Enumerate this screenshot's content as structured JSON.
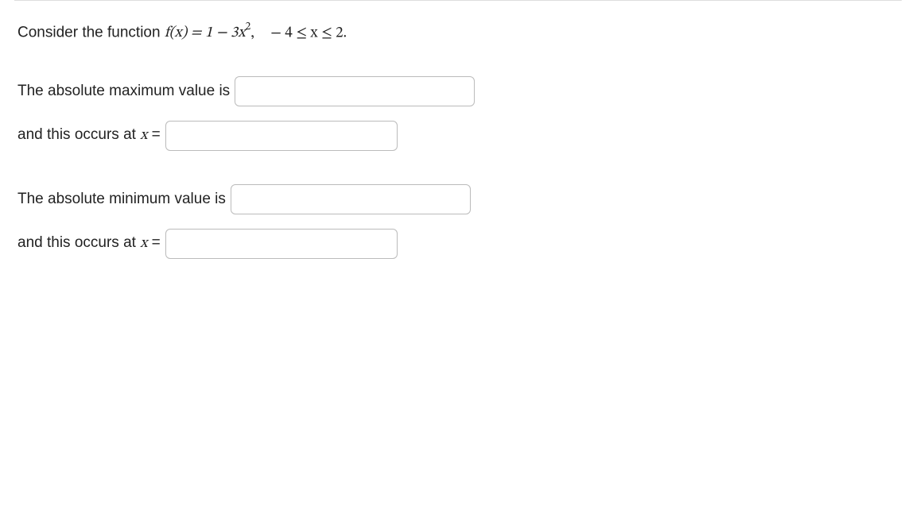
{
  "question": {
    "prefix": "Consider the function ",
    "func_lhs": "f(x) = 1 − 3x",
    "func_exp": "2",
    "comma": ",",
    "domain": " − 4 ≤ x ≤ 2.",
    "max_label": "The absolute maximum value is",
    "occurs_prefix": "and this occurs at ",
    "x_var": "x",
    "equals": " = ",
    "min_label": "The absolute minimum value is"
  },
  "answers": {
    "max_value": "",
    "max_at": "",
    "min_value": "",
    "min_at": ""
  }
}
